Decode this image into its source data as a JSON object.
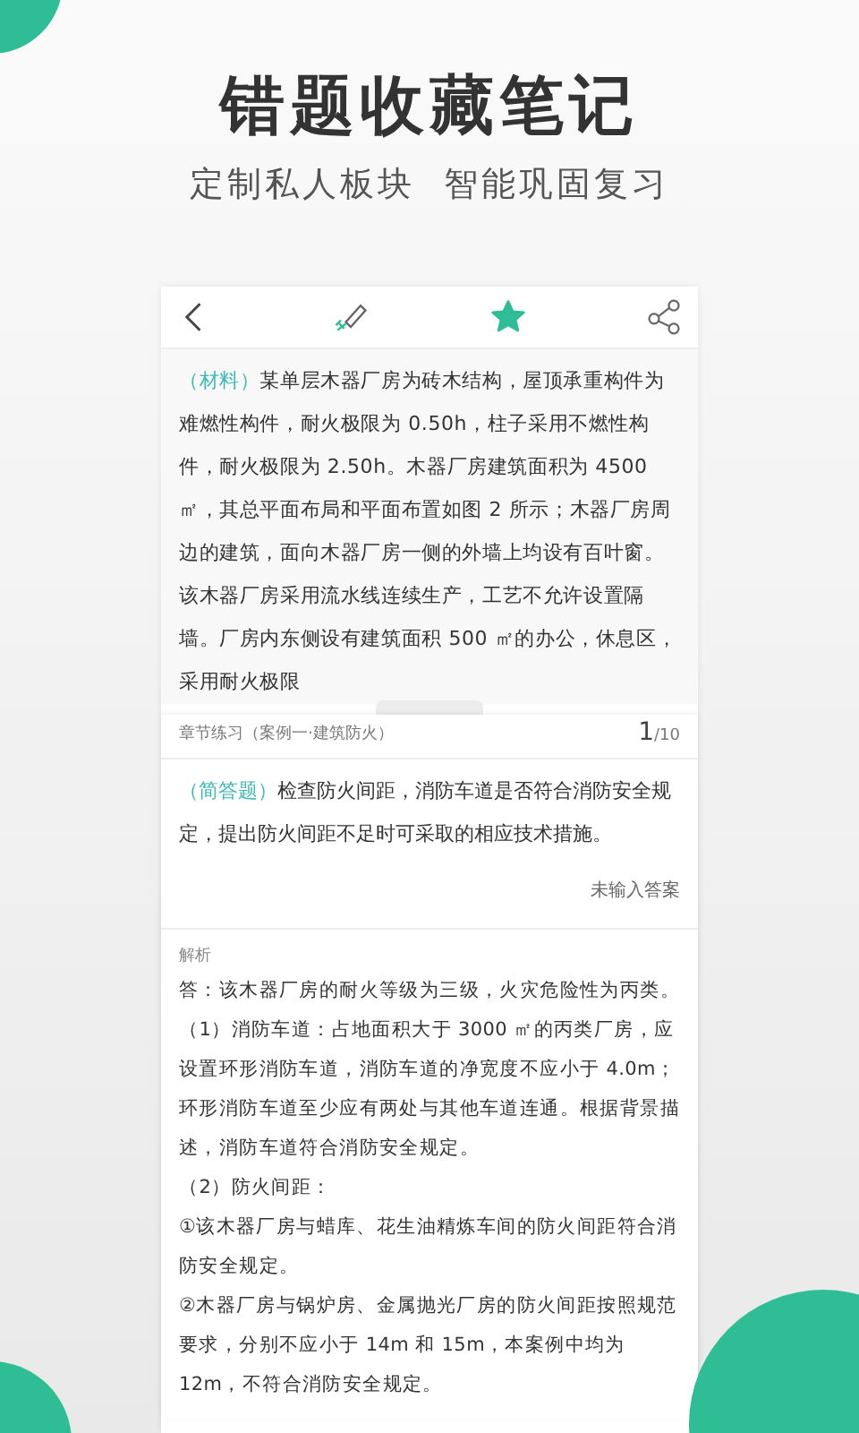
{
  "headline": "错题收藏笔记",
  "subheadline": "定制私人板块  智能巩固复习",
  "toolbar": {
    "favorited": true
  },
  "material": {
    "tag": "（材料）",
    "text": "某单层木器厂房为砖木结构，屋顶承重构件为难燃性构件，耐火极限为 0.50h，柱子采用不燃性构件，耐火极限为 2.50h。木器厂房建筑面积为 4500 ㎡，其总平面布局和平面布置如图 2 所示；木器厂房周边的建筑，面向木器厂房一侧的外墙上均设有百叶窗。该木器厂房采用流水线连续生产，工艺不允许设置隔墙。厂房内东侧设有建筑面积 500 ㎡的办公，休息区，采用耐火极限"
  },
  "question_bar": {
    "chapter": "章节练习（案例一·建筑防火）",
    "current": "1",
    "total": "/10"
  },
  "question": {
    "tag": "（简答题）",
    "text": "检查防火间距，消防车道是否符合消防安全规定，提出防火间距不足时可采取的相应技术措施。",
    "answer_status": "未输入答案"
  },
  "analysis": {
    "heading": "解析",
    "paragraphs": [
      "答：该木器厂房的耐火等级为三级，火灾危险性为丙类。",
      "（1）消防车道：占地面积大于 3000 ㎡的丙类厂房，应设置环形消防车道，消防车道的净宽度不应小于 4.0m；环形消防车道至少应有两处与其他车道连通。根据背景描述，消防车道符合消防安全规定。",
      "（2）防火间距：",
      "①该木器厂房与蜡库、花生油精炼车间的防火间距符合消防安全规定。",
      "②木器厂房与锅炉房、金属抛光厂房的防火间距按照规范要求，分别不应小于 14m 和 15m，本案例中均为 12m，不符合消防安全规定。"
    ]
  }
}
